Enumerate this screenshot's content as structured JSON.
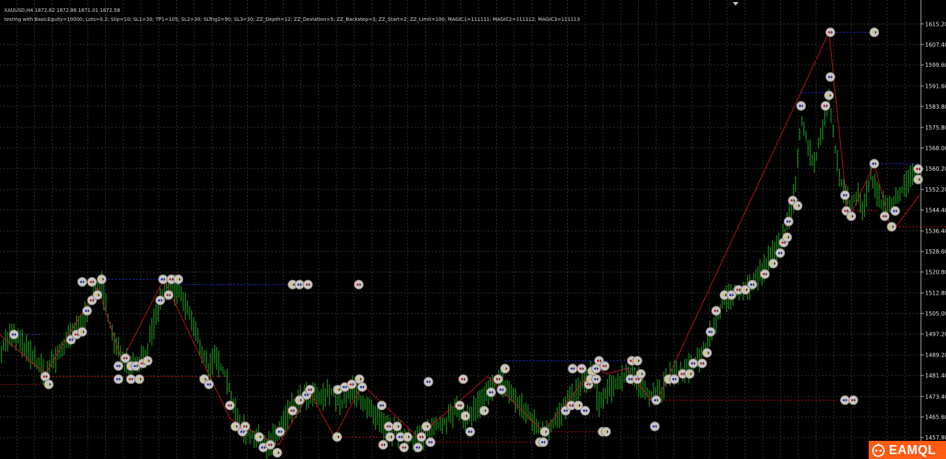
{
  "header": {
    "symbol_line": "XAUUSD,H4  1872.82 1872.86 1871.01 1872.58",
    "params_line": "testing with BasicEquity=10000; Lots=0.2; Slip=10; SL1=30; TP1=105; SL2=30; SLTrig2=90; SL3=30; ZZ_Depth=12; ZZ_Deviation=5; ZZ_Backstep=3; ZZ_Start=2; ZZ_Limit=100; MAGIC1=111111; MAGIC2=111112; MAGIC3=111113"
  },
  "colors": {
    "background": "#000000",
    "grid": "#3a3a3a",
    "candle": "#1fa31f",
    "zigzag": "#c0141b",
    "level_blue": "#1f2fcf",
    "level_red": "#a01010",
    "marker": "#c8c8c8",
    "watermark_bg": "#ff5a14"
  },
  "watermark": {
    "text": "EAMQL"
  },
  "chart_data": {
    "type": "candlestick",
    "y_ticks": [
      "1615.20",
      "1607.40",
      "1599.60",
      "1591.60",
      "1583.80",
      "1575.80",
      "1568.00",
      "1560.20",
      "1552.20",
      "1544.40",
      "1536.40",
      "1528.60",
      "1520.80",
      "1512.80",
      "1505.00",
      "1497.20",
      "1489.20",
      "1481.40",
      "1473.40",
      "1465.60",
      "1457.80"
    ],
    "ylim": [
      1452,
      1619
    ],
    "price_path": [
      [
        0,
        1491
      ],
      [
        15,
        1497
      ],
      [
        30,
        1494
      ],
      [
        45,
        1489
      ],
      [
        65,
        1482
      ],
      [
        80,
        1488
      ],
      [
        100,
        1496
      ],
      [
        115,
        1500
      ],
      [
        130,
        1510
      ],
      [
        145,
        1517
      ],
      [
        155,
        1504
      ],
      [
        165,
        1492
      ],
      [
        180,
        1488
      ],
      [
        195,
        1486
      ],
      [
        210,
        1490
      ],
      [
        220,
        1500
      ],
      [
        235,
        1514
      ],
      [
        255,
        1514
      ],
      [
        270,
        1506
      ],
      [
        285,
        1494
      ],
      [
        300,
        1484
      ],
      [
        310,
        1488
      ],
      [
        325,
        1481
      ],
      [
        340,
        1465
      ],
      [
        355,
        1460
      ],
      [
        370,
        1457
      ],
      [
        385,
        1455
      ],
      [
        400,
        1460
      ],
      [
        415,
        1468
      ],
      [
        430,
        1472
      ],
      [
        445,
        1474
      ],
      [
        460,
        1472
      ],
      [
        475,
        1476
      ],
      [
        490,
        1470
      ],
      [
        505,
        1476
      ],
      [
        520,
        1472
      ],
      [
        535,
        1466
      ],
      [
        550,
        1462
      ],
      [
        565,
        1460
      ],
      [
        580,
        1458
      ],
      [
        595,
        1457
      ],
      [
        610,
        1459
      ],
      [
        625,
        1462
      ],
      [
        640,
        1464
      ],
      [
        655,
        1468
      ],
      [
        670,
        1465
      ],
      [
        685,
        1470
      ],
      [
        700,
        1474
      ],
      [
        715,
        1480
      ],
      [
        730,
        1476
      ],
      [
        745,
        1470
      ],
      [
        760,
        1466
      ],
      [
        775,
        1460
      ],
      [
        790,
        1462
      ],
      [
        805,
        1467
      ],
      [
        820,
        1472
      ],
      [
        835,
        1478
      ],
      [
        850,
        1483
      ],
      [
        860,
        1470
      ],
      [
        875,
        1476
      ],
      [
        890,
        1480
      ],
      [
        905,
        1483
      ],
      [
        920,
        1478
      ],
      [
        935,
        1474
      ],
      [
        950,
        1476
      ],
      [
        965,
        1482
      ],
      [
        980,
        1482
      ],
      [
        995,
        1486
      ],
      [
        1010,
        1490
      ],
      [
        1025,
        1500
      ],
      [
        1035,
        1508
      ],
      [
        1050,
        1512
      ],
      [
        1065,
        1514
      ],
      [
        1080,
        1516
      ],
      [
        1095,
        1522
      ],
      [
        1110,
        1528
      ],
      [
        1120,
        1532
      ],
      [
        1130,
        1538
      ],
      [
        1140,
        1550
      ],
      [
        1150,
        1580
      ],
      [
        1160,
        1568
      ],
      [
        1170,
        1562
      ],
      [
        1180,
        1576
      ],
      [
        1190,
        1586
      ],
      [
        1200,
        1566
      ],
      [
        1210,
        1552
      ],
      [
        1220,
        1546
      ],
      [
        1230,
        1550
      ],
      [
        1240,
        1545
      ],
      [
        1250,
        1558
      ],
      [
        1260,
        1550
      ],
      [
        1270,
        1545
      ],
      [
        1280,
        1548
      ],
      [
        1295,
        1552
      ],
      [
        1305,
        1556
      ],
      [
        1320,
        1558
      ]
    ],
    "zigzag": [
      [
        0,
        1497
      ],
      [
        65,
        1482
      ],
      [
        140,
        1515
      ],
      [
        175,
        1487
      ],
      [
        235,
        1518
      ],
      [
        330,
        1465
      ],
      [
        400,
        1455
      ],
      [
        445,
        1475
      ],
      [
        480,
        1458
      ],
      [
        520,
        1478
      ],
      [
        600,
        1458
      ],
      [
        700,
        1481
      ],
      [
        780,
        1460
      ],
      [
        855,
        1485
      ],
      [
        870,
        1482
      ],
      [
        900,
        1484
      ],
      [
        940,
        1470
      ],
      [
        1190,
        1612
      ],
      [
        1215,
        1548
      ],
      [
        1220,
        1542
      ],
      [
        1255,
        1562
      ],
      [
        1280,
        1536
      ],
      [
        1320,
        1550
      ]
    ],
    "blue_levels": [
      [
        110,
        250,
        1518
      ],
      [
        240,
        430,
        1516
      ],
      [
        15,
        60,
        1497
      ],
      [
        725,
        900,
        1487
      ],
      [
        895,
        915,
        1484
      ],
      [
        1190,
        1260,
        1612
      ],
      [
        1150,
        1195,
        1589
      ],
      [
        1255,
        1320,
        1562
      ],
      [
        1290,
        1320,
        1562
      ]
    ],
    "red_levels": [
      [
        0,
        60,
        1478
      ],
      [
        60,
        330,
        1481
      ],
      [
        480,
        600,
        1458
      ],
      [
        600,
        780,
        1456
      ],
      [
        780,
        860,
        1460
      ],
      [
        940,
        1220,
        1472
      ],
      [
        1220,
        1260,
        1544
      ],
      [
        1280,
        1358,
        1538
      ]
    ],
    "markers": [
      [
        20,
        1497
      ],
      [
        65,
        1481
      ],
      [
        70,
        1478
      ],
      [
        118,
        1517
      ],
      [
        132,
        1517
      ],
      [
        146,
        1518
      ],
      [
        102,
        1495
      ],
      [
        110,
        1497
      ],
      [
        118,
        1498
      ],
      [
        125,
        1506
      ],
      [
        132,
        1510
      ],
      [
        140,
        1512
      ],
      [
        170,
        1485
      ],
      [
        180,
        1488
      ],
      [
        188,
        1485
      ],
      [
        195,
        1485
      ],
      [
        205,
        1486
      ],
      [
        212,
        1487
      ],
      [
        170,
        1480
      ],
      [
        188,
        1480
      ],
      [
        200,
        1480
      ],
      [
        234,
        1518
      ],
      [
        246,
        1518
      ],
      [
        256,
        1518
      ],
      [
        230,
        1510
      ],
      [
        242,
        1512
      ],
      [
        293,
        1480
      ],
      [
        300,
        1478
      ],
      [
        330,
        1470
      ],
      [
        338,
        1462
      ],
      [
        348,
        1460
      ],
      [
        352,
        1462
      ],
      [
        372,
        1458
      ],
      [
        378,
        1454
      ],
      [
        388,
        1455
      ],
      [
        398,
        1452
      ],
      [
        402,
        1460
      ],
      [
        420,
        1468
      ],
      [
        430,
        1472
      ],
      [
        440,
        1474
      ],
      [
        445,
        1476
      ],
      [
        420,
        1516
      ],
      [
        430,
        1516
      ],
      [
        442,
        1516
      ],
      [
        485,
        1476
      ],
      [
        495,
        1477
      ],
      [
        505,
        1478
      ],
      [
        516,
        1480
      ],
      [
        520,
        1477
      ],
      [
        515,
        1516
      ],
      [
        484,
        1458
      ],
      [
        548,
        1470
      ],
      [
        558,
        1462
      ],
      [
        570,
        1462
      ],
      [
        575,
        1458
      ],
      [
        580,
        1454
      ],
      [
        585,
        1458
      ],
      [
        600,
        1454
      ],
      [
        605,
        1458
      ],
      [
        612,
        1462
      ],
      [
        618,
        1456
      ],
      [
        550,
        1455
      ],
      [
        560,
        1458
      ],
      [
        615,
        1479
      ],
      [
        660,
        1470
      ],
      [
        668,
        1466
      ],
      [
        675,
        1460
      ],
      [
        665,
        1480
      ],
      [
        695,
        1468
      ],
      [
        705,
        1475
      ],
      [
        715,
        1480
      ],
      [
        725,
        1484
      ],
      [
        720,
        1476
      ],
      [
        776,
        1456
      ],
      [
        782,
        1460
      ],
      [
        812,
        1468
      ],
      [
        820,
        1470
      ],
      [
        830,
        1470
      ],
      [
        840,
        1468
      ],
      [
        845,
        1478
      ],
      [
        850,
        1483
      ],
      [
        856,
        1484
      ],
      [
        860,
        1487
      ],
      [
        865,
        1460
      ],
      [
        822,
        1484
      ],
      [
        835,
        1484
      ],
      [
        848,
        1480
      ],
      [
        856,
        1480
      ],
      [
        907,
        1487
      ],
      [
        915,
        1487
      ],
      [
        905,
        1480
      ],
      [
        915,
        1480
      ],
      [
        920,
        1482
      ],
      [
        942,
        1472
      ],
      [
        940,
        1462
      ],
      [
        960,
        1480
      ],
      [
        968,
        1480
      ],
      [
        980,
        1482
      ],
      [
        990,
        1482
      ],
      [
        995,
        1486
      ],
      [
        1008,
        1486
      ],
      [
        1015,
        1490
      ],
      [
        1020,
        1498
      ],
      [
        1028,
        1506
      ],
      [
        1040,
        1512
      ],
      [
        1050,
        1512
      ],
      [
        1060,
        1514
      ],
      [
        1070,
        1514
      ],
      [
        1080,
        1516
      ],
      [
        1098,
        1520
      ],
      [
        1110,
        1524
      ],
      [
        1120,
        1528
      ],
      [
        1125,
        1532
      ],
      [
        1130,
        1534
      ],
      [
        1132,
        1540
      ],
      [
        1138,
        1548
      ],
      [
        1145,
        1546
      ],
      [
        1150,
        1584
      ],
      [
        1185,
        1584
      ],
      [
        1190,
        1588
      ],
      [
        1192,
        1595
      ],
      [
        1192,
        1612
      ],
      [
        1255,
        1612
      ],
      [
        1213,
        1550
      ],
      [
        1215,
        1544
      ],
      [
        1222,
        1542
      ],
      [
        1255,
        1562
      ],
      [
        1270,
        1542
      ],
      [
        1280,
        1538
      ],
      [
        1285,
        1544
      ],
      [
        1318,
        1560
      ],
      [
        1318,
        1556
      ],
      [
        1213,
        1472
      ],
      [
        1225,
        1472
      ],
      [
        775,
        1456
      ],
      [
        780,
        1456
      ],
      [
        868,
        1485
      ],
      [
        870,
        1460
      ],
      [
        940,
        1462
      ]
    ]
  }
}
